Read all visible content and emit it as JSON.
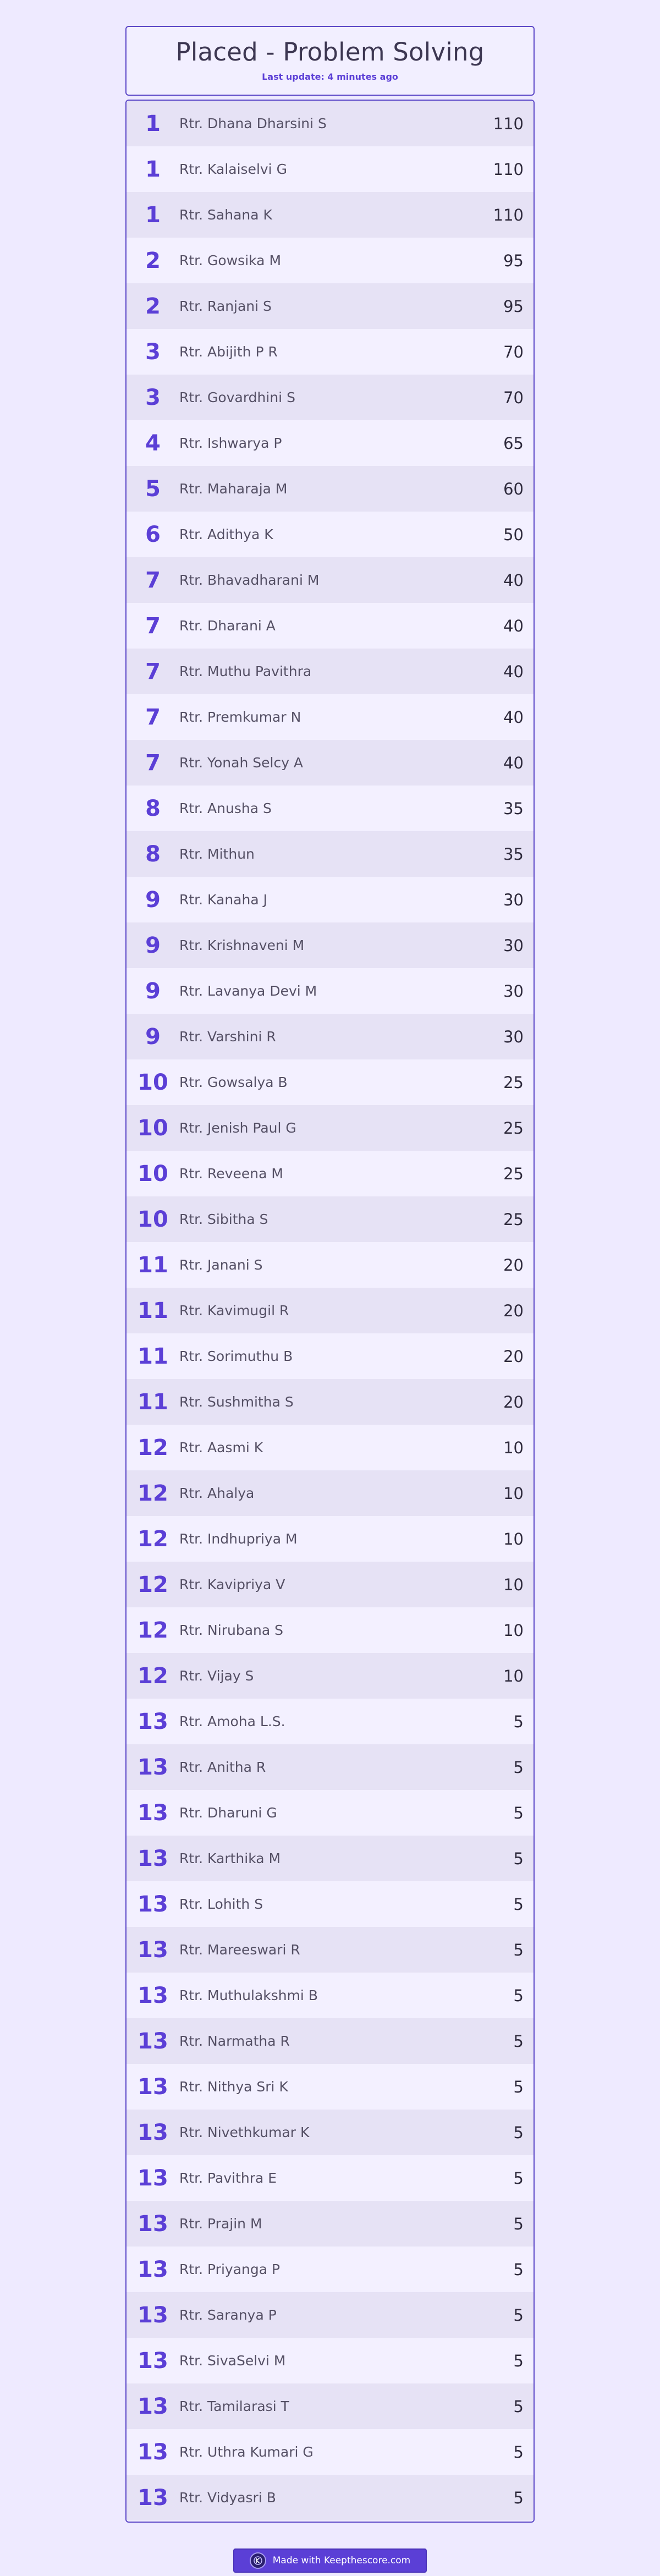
{
  "header": {
    "title": "Placed - Problem Solving",
    "last_update": "Last update: 4 minutes ago"
  },
  "leaderboard": [
    {
      "rank": "1",
      "name": "Rtr. Dhana Dharsini S",
      "score": "110"
    },
    {
      "rank": "1",
      "name": "Rtr. Kalaiselvi G",
      "score": "110"
    },
    {
      "rank": "1",
      "name": "Rtr. Sahana K",
      "score": "110"
    },
    {
      "rank": "2",
      "name": "Rtr. Gowsika M",
      "score": "95"
    },
    {
      "rank": "2",
      "name": "Rtr. Ranjani S",
      "score": "95"
    },
    {
      "rank": "3",
      "name": "Rtr. Abijith P R",
      "score": "70"
    },
    {
      "rank": "3",
      "name": "Rtr. Govardhini S",
      "score": "70"
    },
    {
      "rank": "4",
      "name": "Rtr. Ishwarya P",
      "score": "65"
    },
    {
      "rank": "5",
      "name": "Rtr. Maharaja M",
      "score": "60"
    },
    {
      "rank": "6",
      "name": "Rtr. Adithya K",
      "score": "50"
    },
    {
      "rank": "7",
      "name": "Rtr. Bhavadharani M",
      "score": "40"
    },
    {
      "rank": "7",
      "name": "Rtr. Dharani A",
      "score": "40"
    },
    {
      "rank": "7",
      "name": "Rtr. Muthu Pavithra",
      "score": "40"
    },
    {
      "rank": "7",
      "name": "Rtr. Premkumar N",
      "score": "40"
    },
    {
      "rank": "7",
      "name": "Rtr. Yonah Selcy A",
      "score": "40"
    },
    {
      "rank": "8",
      "name": "Rtr. Anusha S",
      "score": "35"
    },
    {
      "rank": "8",
      "name": "Rtr. Mithun",
      "score": "35"
    },
    {
      "rank": "9",
      "name": "Rtr. Kanaha J",
      "score": "30"
    },
    {
      "rank": "9",
      "name": "Rtr. Krishnaveni M",
      "score": "30"
    },
    {
      "rank": "9",
      "name": "Rtr. Lavanya Devi M",
      "score": "30"
    },
    {
      "rank": "9",
      "name": "Rtr. Varshini R",
      "score": "30"
    },
    {
      "rank": "10",
      "name": "Rtr. Gowsalya B",
      "score": "25"
    },
    {
      "rank": "10",
      "name": "Rtr. Jenish Paul G",
      "score": "25"
    },
    {
      "rank": "10",
      "name": "Rtr. Reveena M",
      "score": "25"
    },
    {
      "rank": "10",
      "name": "Rtr. Sibitha S",
      "score": "25"
    },
    {
      "rank": "11",
      "name": "Rtr. Janani S",
      "score": "20"
    },
    {
      "rank": "11",
      "name": "Rtr. Kavimugil R",
      "score": "20"
    },
    {
      "rank": "11",
      "name": "Rtr. Sorimuthu B",
      "score": "20"
    },
    {
      "rank": "11",
      "name": "Rtr. Sushmitha S",
      "score": "20"
    },
    {
      "rank": "12",
      "name": "Rtr. Aasmi K",
      "score": "10"
    },
    {
      "rank": "12",
      "name": "Rtr. Ahalya",
      "score": "10"
    },
    {
      "rank": "12",
      "name": "Rtr. Indhupriya M",
      "score": "10"
    },
    {
      "rank": "12",
      "name": "Rtr. Kavipriya V",
      "score": "10"
    },
    {
      "rank": "12",
      "name": "Rtr. Nirubana S",
      "score": "10"
    },
    {
      "rank": "12",
      "name": "Rtr. Vijay S",
      "score": "10"
    },
    {
      "rank": "13",
      "name": "Rtr. Amoha L.S.",
      "score": "5"
    },
    {
      "rank": "13",
      "name": "Rtr. Anitha R",
      "score": "5"
    },
    {
      "rank": "13",
      "name": "Rtr. Dharuni G",
      "score": "5"
    },
    {
      "rank": "13",
      "name": "Rtr. Karthika M",
      "score": "5"
    },
    {
      "rank": "13",
      "name": "Rtr. Lohith S",
      "score": "5"
    },
    {
      "rank": "13",
      "name": "Rtr. Mareeswari R",
      "score": "5"
    },
    {
      "rank": "13",
      "name": "Rtr. Muthulakshmi B",
      "score": "5"
    },
    {
      "rank": "13",
      "name": "Rtr. Narmatha R",
      "score": "5"
    },
    {
      "rank": "13",
      "name": "Rtr. Nithya Sri K",
      "score": "5"
    },
    {
      "rank": "13",
      "name": "Rtr. Nivethkumar K",
      "score": "5"
    },
    {
      "rank": "13",
      "name": "Rtr. Pavithra E",
      "score": "5"
    },
    {
      "rank": "13",
      "name": "Rtr. Prajin M",
      "score": "5"
    },
    {
      "rank": "13",
      "name": "Rtr. Priyanga P",
      "score": "5"
    },
    {
      "rank": "13",
      "name": "Rtr. Saranya P",
      "score": "5"
    },
    {
      "rank": "13",
      "name": "Rtr. SivaSelvi M",
      "score": "5"
    },
    {
      "rank": "13",
      "name": "Rtr. Tamilarasi T",
      "score": "5"
    },
    {
      "rank": "13",
      "name": "Rtr. Uthra Kumari G",
      "score": "5"
    },
    {
      "rank": "13",
      "name": "Rtr. Vidyasri B",
      "score": "5"
    }
  ],
  "footer": {
    "button_label": "Made with Keepthescore.com",
    "logo_icon": "keepthescore-logo-icon"
  },
  "colors": {
    "background": "#eeeaff",
    "accent": "#5b3fd6",
    "row_alt": "#e6e2f5",
    "border": "#5b47c7"
  }
}
